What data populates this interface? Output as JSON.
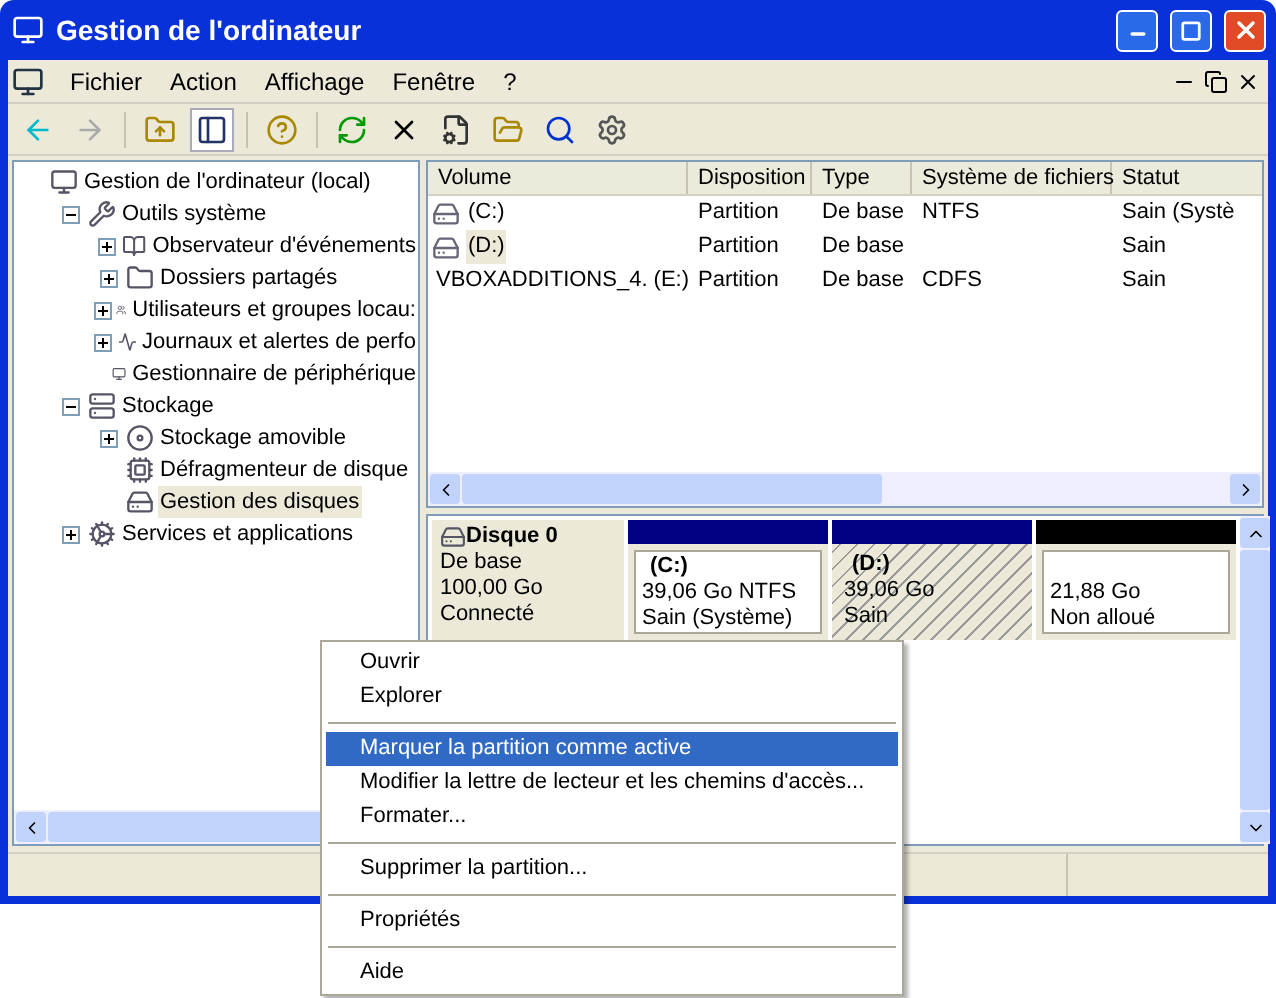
{
  "window": {
    "title": "Gestion de l'ordinateur"
  },
  "menu_bar": [
    "Fichier",
    "Action",
    "Affichage",
    "Fenêtre",
    "?"
  ],
  "tree": [
    {
      "label": "Gestion de l'ordinateur (local)",
      "selected": false,
      "children": [
        {
          "label": "Outils système",
          "expanded": true,
          "selected": false,
          "children": [
            {
              "label": "Observateur d'événements",
              "expanded": false,
              "selected": false
            },
            {
              "label": "Dossiers partagés",
              "expanded": false,
              "selected": false
            },
            {
              "label": "Utilisateurs et groupes locau:",
              "expanded": false,
              "selected": false
            },
            {
              "label": "Journaux et alertes de perfo",
              "expanded": false,
              "selected": false
            },
            {
              "label": "Gestionnaire de périphérique",
              "selected": false
            }
          ]
        },
        {
          "label": "Stockage",
          "expanded": true,
          "selected": false,
          "children": [
            {
              "label": "Stockage amovible",
              "expanded": false,
              "selected": false
            },
            {
              "label": "Défragmenteur de disque",
              "selected": false
            },
            {
              "label": "Gestion des disques",
              "selected": true
            }
          ]
        },
        {
          "label": "Services et applications",
          "expanded": false,
          "selected": false
        }
      ]
    }
  ],
  "table": {
    "columns": [
      "Volume",
      "Disposition",
      "Type",
      "Système de fichiers",
      "Statut"
    ],
    "rows": [
      {
        "cells": [
          "(C:)",
          "Partition",
          "De base",
          "NTFS",
          "Sain (Systè"
        ],
        "selected": false
      },
      {
        "cells": [
          "(D:)",
          "Partition",
          "De base",
          "",
          "Sain"
        ],
        "selected": true
      },
      {
        "cells": [
          "VBOXADDITIONS_4. (E:)",
          "Partition",
          "De base",
          "CDFS",
          "Sain"
        ],
        "selected": false
      }
    ]
  },
  "disk": {
    "name": "Disque 0",
    "lines": [
      "De base",
      "100,00 Go",
      "Connecté"
    ],
    "partitions": [
      {
        "label": "(C:)",
        "lines": [
          "39,06 Go NTFS",
          "Sain (Système)"
        ],
        "color": "#000080",
        "selected": false
      },
      {
        "label": "(D:)",
        "lines": [
          "39,06 Go",
          "Sain"
        ],
        "color": "#000080",
        "selected": true
      },
      {
        "lines": [
          "21,88 Go",
          "Non alloué"
        ],
        "color": "#000000",
        "selected": false
      }
    ]
  },
  "context_menu": [
    {
      "kind": "item",
      "label": "Ouvrir",
      "selected": false
    },
    {
      "kind": "item",
      "label": "Explorer",
      "selected": false
    },
    {
      "kind": "separator"
    },
    {
      "kind": "item",
      "label": "Marquer la partition comme active",
      "selected": true
    },
    {
      "kind": "item",
      "label": "Modifier la lettre de lecteur et les chemins d'accès...",
      "selected": false
    },
    {
      "kind": "item",
      "label": "Formater...",
      "selected": false
    },
    {
      "kind": "separator"
    },
    {
      "kind": "item",
      "label": "Supprimer la partition...",
      "selected": false
    },
    {
      "kind": "separator"
    },
    {
      "kind": "item",
      "label": "Propriétés",
      "selected": false
    },
    {
      "kind": "separator"
    },
    {
      "kind": "item",
      "label": "Aide",
      "selected": false
    }
  ]
}
